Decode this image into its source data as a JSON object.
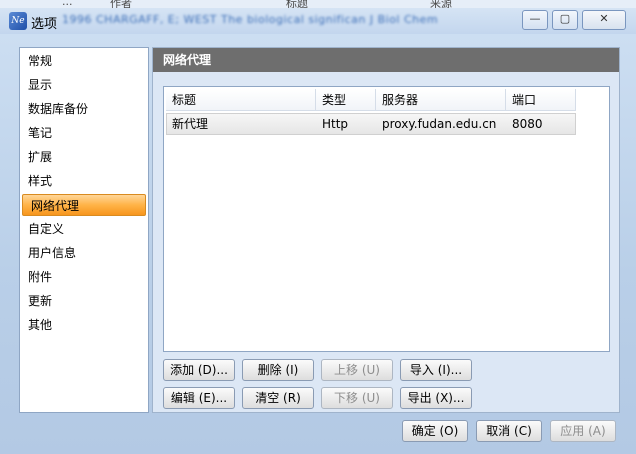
{
  "window": {
    "title": "选项",
    "app_icon": "Ne",
    "bg_strip": [
      "...",
      "作者",
      "标题",
      "来源"
    ],
    "blurred_text": "1996   CHARGAFF, E; WEST   The biological significan   J Biol Chem",
    "controls": {
      "minimize": "—",
      "maximize": "▢",
      "close": "✕"
    }
  },
  "sidebar": {
    "items": [
      "常规",
      "显示",
      "数据库备份",
      "笔记",
      "扩展",
      "样式",
      "网络代理",
      "自定义",
      "用户信息",
      "附件",
      "更新",
      "其他"
    ],
    "selected": "网络代理"
  },
  "panel": {
    "title": "网络代理",
    "columns": [
      "标题",
      "类型",
      "服务器",
      "端口"
    ],
    "rows": [
      {
        "title": "新代理",
        "type": "Http",
        "server": "proxy.fudan.edu.cn",
        "port": "8080"
      }
    ]
  },
  "buttons": {
    "add": "添加 (D)...",
    "delete": "删除 (I)",
    "move_up": "上移 (U)",
    "import": "导入 (I)...",
    "edit": "编辑 (E)...",
    "clear": "清空 (R)",
    "move_down": "下移 (U)",
    "export": "导出 (X)...",
    "ok": "确定 (O)",
    "cancel": "取消 (C)",
    "apply": "应用 (A)"
  }
}
